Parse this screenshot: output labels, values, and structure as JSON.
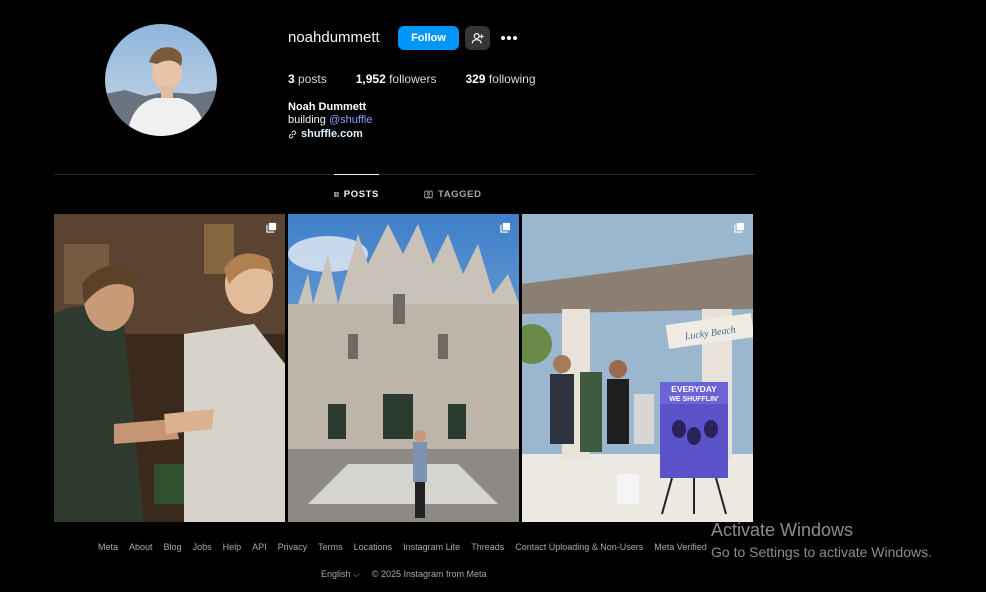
{
  "profile": {
    "username": "noahdummett",
    "follow_label": "Follow",
    "full_name": "Noah Dummett",
    "bio_prefix": "building ",
    "bio_mention": "@shuffle",
    "link": "shuffle.com",
    "accent_color": "#0095f6"
  },
  "stats": {
    "posts_count": "3",
    "posts_label": "posts",
    "followers_count": "1,952",
    "followers_label": "followers",
    "following_count": "329",
    "following_label": "following"
  },
  "tabs": {
    "posts": "POSTS",
    "tagged": "TAGGED",
    "active": "posts"
  },
  "posts": [
    {
      "subject": "handshake",
      "icon": "carousel-icon"
    },
    {
      "subject": "cathedral",
      "icon": "carousel-icon"
    },
    {
      "subject": "shuffle-booth",
      "icon": "carousel-icon",
      "sign_line1": "EVERYDAY",
      "sign_line2": "WE SHUFFLIN'",
      "banner": "Lucky Beach"
    }
  ],
  "footer": {
    "links": [
      "Meta",
      "About",
      "Blog",
      "Jobs",
      "Help",
      "API",
      "Privacy",
      "Terms",
      "Locations",
      "Instagram Lite",
      "Threads",
      "Contact Uploading & Non-Users",
      "Meta Verified"
    ],
    "language": "English",
    "copyright": "© 2025 Instagram from Meta"
  },
  "watermark": {
    "title": "Activate Windows",
    "subtitle": "Go to Settings to activate Windows."
  }
}
